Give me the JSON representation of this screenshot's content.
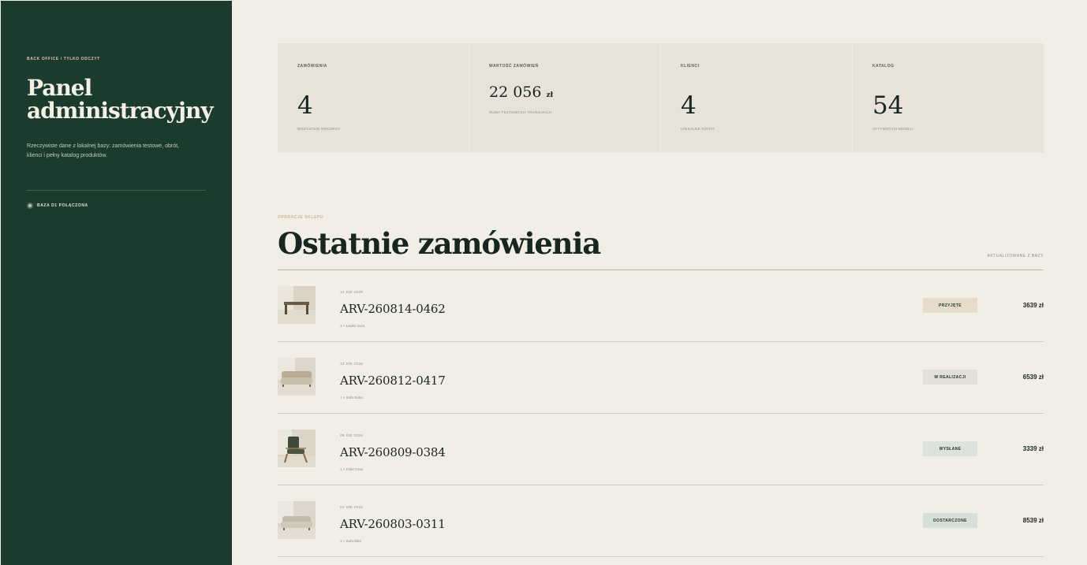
{
  "sidebar": {
    "eyebrow": "BACK OFFICE / TYLKO ODCZYT",
    "title": "Panel administracyjny",
    "description": "Rzeczywiste dane z lokalnej bazy: zamówienia testowe, obrót, klienci i pełny katalog produktów.",
    "status": "BAZA D1 POŁĄCZONA"
  },
  "stats": [
    {
      "label": "ZAMÓWIENIA",
      "value": "4",
      "sub": "WSZYSTKIE REKORDY"
    },
    {
      "label": "WARTOŚĆ ZAMÓWIEŃ",
      "value": "22 056",
      "unit": "zł",
      "sub": "SUMA TESTOWYCH TRANSAKCJI"
    },
    {
      "label": "KLIENCI",
      "value": "4",
      "sub": "UNIKALNE KONTA"
    },
    {
      "label": "KATALOG",
      "value": "54",
      "sub": "AKTYWNYCH MODELI"
    }
  ],
  "orders_section": {
    "eyebrow": "OPERACJE SKLEPU",
    "title": "Ostatnie zamówienia",
    "meta": "AKTUALIZOWANE Z BAZY"
  },
  "orders": [
    {
      "date": "14 SIE 2026",
      "id": "ARV-260814-0462",
      "items": "1 × Ławka Sora",
      "status": "PRZYJĘTE",
      "status_color": "#e5dccb",
      "total": "3639 zł",
      "thumb": "bench-photo"
    },
    {
      "date": "12 SIE 2026",
      "id": "ARV-260812-0417",
      "items": "1 × Sofa Nubo",
      "status": "W REALIZACJI",
      "status_color": "#e2e1d8",
      "total": "6539 zł",
      "thumb": "sofa-photo"
    },
    {
      "date": "09 SIE 2026",
      "id": "ARV-260809-0384",
      "items": "1 × Fotel Cavo",
      "status": "WYSŁANE",
      "status_color": "#dce3dc",
      "total": "3339 zł",
      "thumb": "armchair-photo"
    },
    {
      "date": "03 SIE 2026",
      "id": "ARV-260803-0311",
      "items": "1 × Sofa Mira",
      "status": "DOSTARCZONE",
      "status_color": "#d5e0d8",
      "total": "8539 zł",
      "thumb": "sofa-photo"
    }
  ]
}
